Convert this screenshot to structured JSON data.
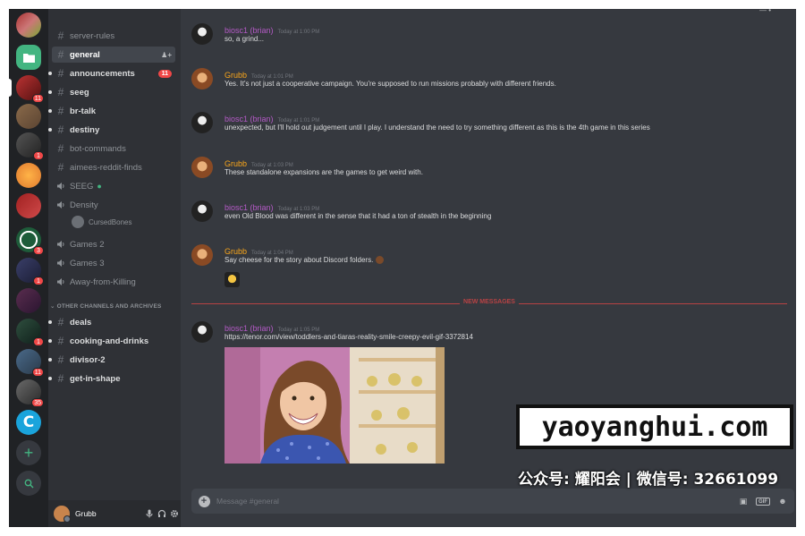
{
  "rail": {
    "badges": [
      "11",
      "1",
      "3",
      "1",
      "1",
      "11",
      "35"
    ]
  },
  "channels": {
    "text": [
      {
        "label": "server-rules"
      },
      {
        "label": "general"
      },
      {
        "label": "announcements",
        "mentions": "11"
      },
      {
        "label": "seeg"
      },
      {
        "label": "br-talk"
      },
      {
        "label": "destiny"
      },
      {
        "label": "bot-commands"
      },
      {
        "label": "aimees-reddit-finds"
      }
    ],
    "voice": [
      {
        "label": "SEEG"
      },
      {
        "label": "Density"
      },
      {
        "label": "Games 2"
      },
      {
        "label": "Games 3"
      },
      {
        "label": "Away-from-Killing"
      }
    ],
    "voice_user": "CursedBones",
    "category": "OTHER CHANNELS AND ARCHIVES",
    "archived": [
      {
        "label": "deals"
      },
      {
        "label": "cooking-and-drinks"
      },
      {
        "label": "divisor-2"
      },
      {
        "label": "get-in-shape"
      }
    ]
  },
  "user_panel": {
    "username": "Grubb"
  },
  "messages": [
    {
      "author": "biosc1 (brian)",
      "time": "Today at 1:00 PM",
      "text": "so, a grind..."
    },
    {
      "author": "Grubb",
      "time": "Today at 1:01 PM",
      "text": "Yes. It's not just a cooperative campaign. You're supposed to run missions probably with different friends."
    },
    {
      "author": "biosc1 (brian)",
      "time": "Today at 1:01 PM",
      "text": "unexpected, but I'll hold out judgement until I play.  I understand the need to try something different as this is the 4th game in this series"
    },
    {
      "author": "Grubb",
      "time": "Today at 1:03 PM",
      "text": "These standalone expansions are the games to get weird with."
    },
    {
      "author": "biosc1 (brian)",
      "time": "Today at 1:03 PM",
      "text": "even Old Blood was different in the sense that it had a ton of stealth in the beginning"
    },
    {
      "author": "Grubb",
      "time": "Today at 1:04 PM",
      "text": "Say cheese for the story about Discord folders."
    },
    {
      "author": "biosc1 (brian)",
      "time": "Today at 1:05 PM",
      "text": "https://tenor.com/view/toddlers-and-tiaras-reality-smile-creepy-evil-gif-3372814"
    }
  ],
  "divider": "NEW MESSAGES",
  "composer": {
    "placeholder": "Message #general"
  },
  "watermark": {
    "site": "yaoyanghui.com",
    "sub": "公众号: 耀阳会 | 微信号: 32661099"
  },
  "colors": {
    "rail": "#202225",
    "channels": "#2f3136",
    "chat": "#36393f",
    "brian": "#b45ac6",
    "grubb": "#faa61a",
    "link": "#00b0f4",
    "alert": "#f04747"
  }
}
